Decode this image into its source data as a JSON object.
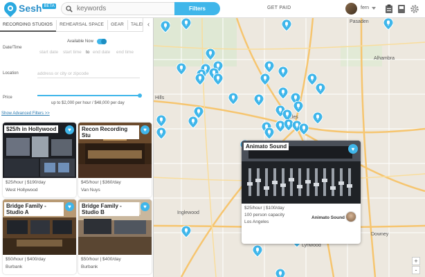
{
  "header": {
    "logo_text": "Sesh",
    "logo_badge": "BETA",
    "search_placeholder": "keywords",
    "filters_label": "Filters",
    "get_paid_label": "GET PAID",
    "username": "fern"
  },
  "tabs": [
    {
      "label": "RECORDING STUDIOS"
    },
    {
      "label": "REHEARSAL SPACE"
    },
    {
      "label": "GEAR"
    },
    {
      "label": "TALENT"
    }
  ],
  "filters": {
    "available_now_label": "Available Now",
    "available_now_on": true,
    "date_time_label": "Date/Time",
    "start_date_placeholder": "start date",
    "start_time_placeholder": "start time",
    "to_label": "to",
    "end_date_placeholder": "end date",
    "end_time_placeholder": "end time",
    "location_label": "Location",
    "location_placeholder": "address or city or zipcode",
    "price_label": "Price",
    "price_range_text": "up to $2,000 per hour / $48,000 per day",
    "advanced_link": "Show Advanced Filters >>"
  },
  "listings": [
    {
      "title": "$25/h in Hollywood",
      "price": "$25/hour | $190/day",
      "location": "West Hollywood"
    },
    {
      "title": "Recon Recording Stu",
      "price": "$45/hour | $360/day",
      "location": "Van Nuys"
    },
    {
      "title": "Bridge Family - Studio A",
      "price": "$50/hour | $400/day",
      "location": "Burbank"
    },
    {
      "title": "Bridge Family - Studio B",
      "price": "$50/hour | $400/day",
      "location": "Burbank"
    }
  ],
  "map": {
    "labels": [
      "Pasaden",
      "Alhambra",
      "Hills",
      "geles",
      "Inglewood",
      "Lynwood",
      "Downey"
    ],
    "zoom_in": "+",
    "zoom_out": "-"
  },
  "popup": {
    "title": "Animato Sound",
    "price": "$25/hour | $100/day",
    "capacity": "100 person capacity",
    "location": "Los Angeles",
    "host_name": "Animato Sound"
  },
  "colors": {
    "accent": "#3fb6ea",
    "map_bg": "#ede8df",
    "road": "#f6c56f"
  }
}
